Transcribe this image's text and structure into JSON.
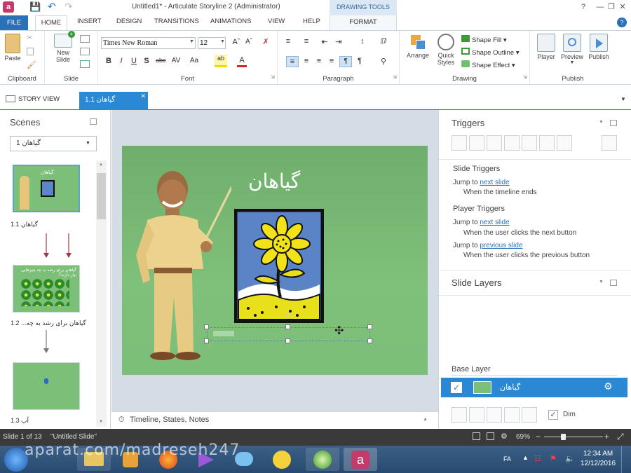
{
  "window": {
    "title": "Untitled1* -  Articulate Storyline 2 (Administrator)",
    "contextual_tab": "DRAWING TOOLS"
  },
  "ribbon_tabs": {
    "file": "FILE",
    "home": "HOME",
    "insert": "INSERT",
    "design": "DESIGN",
    "transitions": "TRANSITIONS",
    "animations": "ANIMATIONS",
    "view": "VIEW",
    "help": "HELP",
    "format": "FORMAT"
  },
  "ribbon": {
    "clipboard": {
      "label": "Clipboard",
      "paste": "Paste"
    },
    "slide": {
      "label": "Slide",
      "new_slide_line1": "New",
      "new_slide_line2": "Slide"
    },
    "font": {
      "label": "Font",
      "family": "Times New Roman",
      "size": "12"
    },
    "paragraph": {
      "label": "Paragraph"
    },
    "drawing": {
      "label": "Drawing",
      "arrange": "Arrange",
      "quick_styles_line1": "Quick",
      "quick_styles_line2": "Styles",
      "shape_fill": "Shape Fill",
      "shape_outline": "Shape Outline",
      "shape_effect": "Shape Effect"
    },
    "publish": {
      "label": "Publish",
      "player": "Player",
      "preview": "Preview",
      "publish": "Publish"
    }
  },
  "doc_tabs": {
    "story_view": "STORY VIEW",
    "slide": "گیاهان 1.1"
  },
  "scenes": {
    "header": "Scenes",
    "selected_scene": "گیاهان 1",
    "thumbs": [
      {
        "label": "گیاهان 1.1",
        "title": "گیاهان"
      },
      {
        "label": "1.2 ...گیاهان برای رشد به چه",
        "title": "گیاهان برای رشد به چه چیزهایی نیاز دارند؟"
      },
      {
        "label": "آب 1.3"
      }
    ]
  },
  "slide": {
    "title": "گیاهان"
  },
  "timeline_bar": {
    "label": "Timeline, States, Notes"
  },
  "triggers": {
    "header": "Triggers",
    "slide_triggers_heading": "Slide Triggers",
    "player_triggers_heading": "Player Triggers",
    "items": [
      {
        "action": "Jump to",
        "target": "next slide",
        "when": "When the timeline ends"
      },
      {
        "action": "Jump to",
        "target": "next slide",
        "when": "When the user clicks the next button"
      },
      {
        "action": "Jump to",
        "target": "previous slide",
        "when": "When the user clicks the previous button"
      }
    ]
  },
  "slide_layers": {
    "header": "Slide Layers",
    "base_layer_label": "Base Layer",
    "base_layer_name": "گیاهان",
    "dim_label": "Dim"
  },
  "status_bar": {
    "slide_count": "Slide 1 of 13",
    "slide_name": "\"Untitled Slide\"",
    "zoom": "69%"
  },
  "taskbar": {
    "lang": "FA",
    "time": "12:34 AM",
    "date": "12/12/2016"
  },
  "watermark": "aparat.com/madreseh247",
  "colors": {
    "accent": "#2a72b8",
    "selected_tab": "#2a88d4",
    "slide_bg": "#7cbf79"
  }
}
